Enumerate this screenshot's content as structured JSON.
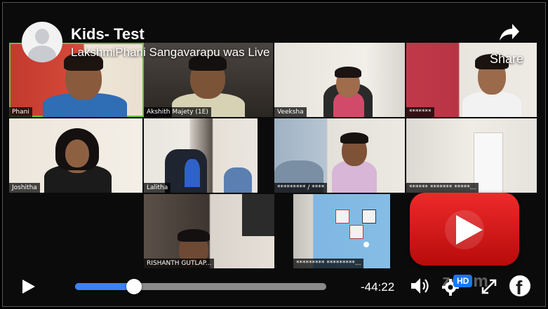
{
  "header": {
    "title": "Kids- Test",
    "subtitle": "LakshmiPhani Sangavarapu was Live",
    "share_label": "Share"
  },
  "participants": [
    {
      "name": "Phani"
    },
    {
      "name": "Akshith Majety (1E)"
    },
    {
      "name": "Veeksha"
    },
    {
      "name": "*******"
    },
    {
      "name": "Joshitha"
    },
    {
      "name": "Lalitha"
    },
    {
      "name": "********* / ****"
    },
    {
      "name": "****** ******* *****..."
    },
    {
      "name": "RISHANTH GUTLAP..."
    },
    {
      "name": "********* *********..."
    }
  ],
  "controls": {
    "time_remaining": "-44:22",
    "progress_fraction": 0.235,
    "hd_label": "HD",
    "watermark": "zoom",
    "facebook_glyph": "f"
  },
  "icons": {
    "play": "play-icon",
    "volume": "volume-icon",
    "settings": "gear-icon",
    "expand": "expand-icon",
    "share": "share-arrow-icon"
  },
  "colors": {
    "seek_fill": "#3b82f6",
    "speaker_outline": "#6ac13a",
    "hd_badge": "#1877f2"
  }
}
